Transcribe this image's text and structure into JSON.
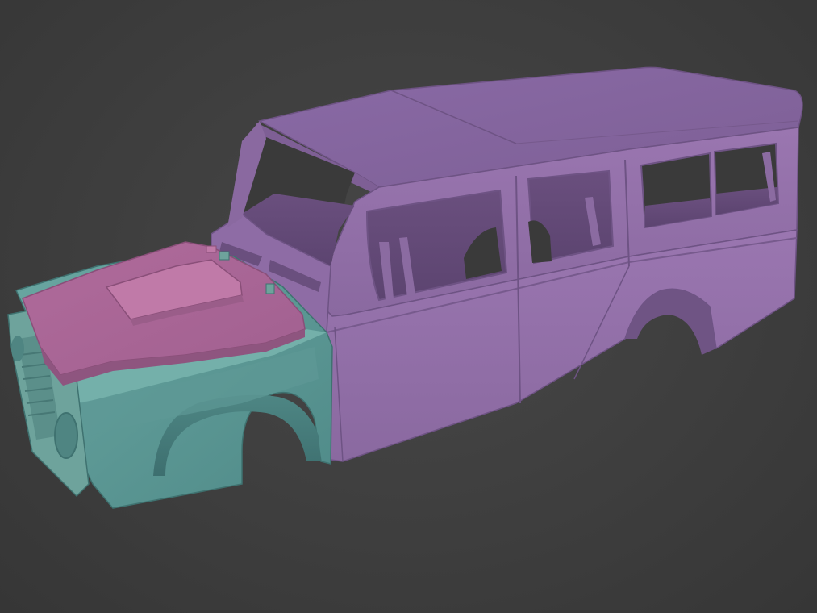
{
  "viewport": {
    "background_color": "#3f3f3f"
  },
  "model": {
    "parts": [
      {
        "name": "roof",
        "color": "#8a6ba3"
      },
      {
        "name": "body-rear",
        "color": "#9470aa"
      },
      {
        "name": "front-fender",
        "color": "#5f9b97"
      },
      {
        "name": "bonnet",
        "color": "#b06a98"
      },
      {
        "name": "grille",
        "color": "#6ea39c"
      }
    ]
  }
}
